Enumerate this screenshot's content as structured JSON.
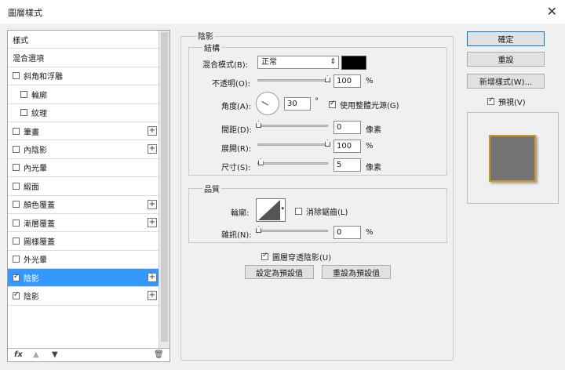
{
  "window": {
    "title": "圖層樣式",
    "close_icon": "close-icon"
  },
  "style_list": {
    "items": [
      {
        "label": "樣式",
        "checkbox": false,
        "sub": false,
        "plus": false
      },
      {
        "label": "混合選項",
        "checkbox": false,
        "sub": false,
        "plus": false
      },
      {
        "label": "斜角和浮雕",
        "checkbox": true,
        "checked": false,
        "sub": false,
        "plus": false
      },
      {
        "label": "輪廓",
        "checkbox": true,
        "checked": false,
        "sub": true,
        "plus": false
      },
      {
        "label": "紋理",
        "checkbox": true,
        "checked": false,
        "sub": true,
        "plus": false
      },
      {
        "label": "筆畫",
        "checkbox": true,
        "checked": false,
        "sub": false,
        "plus": true
      },
      {
        "label": "內陰影",
        "checkbox": true,
        "checked": false,
        "sub": false,
        "plus": true
      },
      {
        "label": "內光暈",
        "checkbox": true,
        "checked": false,
        "sub": false,
        "plus": false
      },
      {
        "label": "緞面",
        "checkbox": true,
        "checked": false,
        "sub": false,
        "plus": false
      },
      {
        "label": "顏色覆蓋",
        "checkbox": true,
        "checked": false,
        "sub": false,
        "plus": true
      },
      {
        "label": "漸層覆蓋",
        "checkbox": true,
        "checked": false,
        "sub": false,
        "plus": true
      },
      {
        "label": "圖樣覆蓋",
        "checkbox": true,
        "checked": false,
        "sub": false,
        "plus": false
      },
      {
        "label": "外光暈",
        "checkbox": true,
        "checked": false,
        "sub": false,
        "plus": false
      },
      {
        "label": "陰影",
        "checkbox": true,
        "checked": true,
        "sub": false,
        "plus": true,
        "selected": true
      },
      {
        "label": "陰影",
        "checkbox": true,
        "checked": true,
        "sub": false,
        "plus": true
      }
    ],
    "bottom_icons": {
      "fx": "fx",
      "up": "▲",
      "down": "▼",
      "trash": "🗑"
    }
  },
  "drop_shadow": {
    "section_title": "陰影",
    "structure_title": "結構",
    "blend_mode_label": "混合模式(B):",
    "blend_mode_value": "正常",
    "shadow_color": "#000000",
    "opacity_label": "不透明(O):",
    "opacity_value": "100",
    "opacity_unit": "%",
    "opacity_level": 1.0,
    "angle_label": "角度(A):",
    "angle_value": "30",
    "angle_unit": "°",
    "global_light_label": "使用整體光源(G)",
    "global_light_checked": true,
    "distance_label": "間距(D):",
    "distance_value": "0",
    "distance_unit": "像素",
    "distance_level": 0.0,
    "spread_label": "展開(R):",
    "spread_value": "100",
    "spread_unit": "%",
    "spread_level": 1.0,
    "size_label": "尺寸(S):",
    "size_value": "5",
    "size_unit": "像素",
    "size_level": 0.03,
    "quality_title": "品質",
    "contour_label": "輪廓:",
    "anti_alias_label": "消除鋸齒(L)",
    "anti_alias_checked": false,
    "noise_label": "雜訊(N):",
    "noise_value": "0",
    "noise_unit": "%",
    "noise_level": 0.0,
    "knockout_label": "圖層穿透陰影(U)",
    "knockout_checked": true,
    "make_default_label": "設定為預設值",
    "reset_default_label": "重設為預設值"
  },
  "right": {
    "ok_label": "確定",
    "reset_label": "重設",
    "new_style_label": "新增樣式(W)...",
    "preview_label": "預視(V)",
    "preview_checked": true
  },
  "colors": {
    "selection": "#3399ff",
    "preview_fill": "#737373",
    "preview_border": "#c99a1e"
  }
}
